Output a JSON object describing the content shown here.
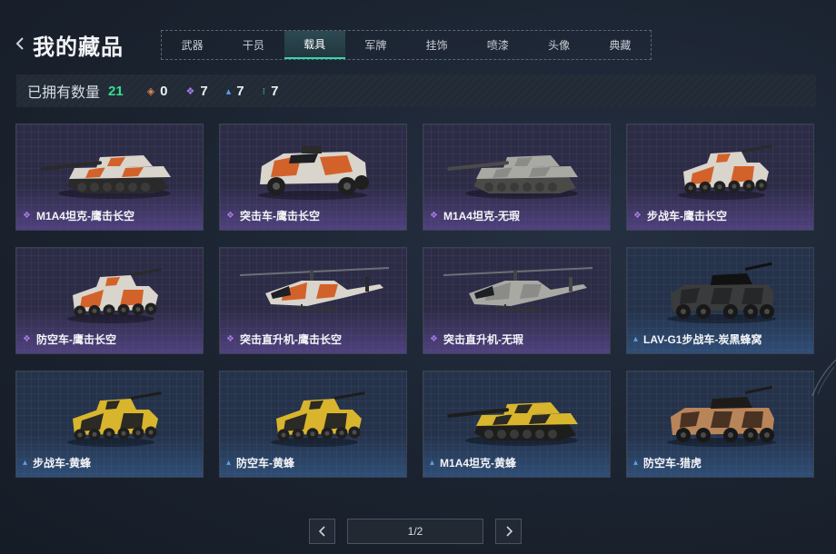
{
  "header": {
    "title": "我的藏品",
    "tabs": [
      "武器",
      "干员",
      "载具",
      "军牌",
      "挂饰",
      "喷漆",
      "头像",
      "典藏"
    ],
    "active_tab": 2
  },
  "owned": {
    "label": "已拥有数量",
    "total": "21",
    "rarities": [
      {
        "icon": "orange-diamond-icon",
        "color": "#e0894a",
        "count": "0"
      },
      {
        "icon": "purple-diamond-icon",
        "color": "#a77be6",
        "count": "7"
      },
      {
        "icon": "blue-chevron-icon",
        "color": "#5b9ee8",
        "count": "7"
      },
      {
        "icon": "green-dots-icon",
        "color": "#3fd6a0",
        "count": "7"
      }
    ]
  },
  "items": [
    {
      "name": "M1A4坦克-鹰击长空",
      "rarity": "purple",
      "art": "tank",
      "camo": "orange"
    },
    {
      "name": "突击车-鹰击长空",
      "rarity": "purple",
      "art": "truck",
      "camo": "orange"
    },
    {
      "name": "M1A4坦克-无瑕",
      "rarity": "purple",
      "art": "tank",
      "camo": "gray"
    },
    {
      "name": "步战车-鹰击长空",
      "rarity": "purple",
      "art": "ifv",
      "camo": "orange"
    },
    {
      "name": "防空车-鹰击长空",
      "rarity": "purple",
      "art": "ifv",
      "camo": "orange"
    },
    {
      "name": "突击直升机-鹰击长空",
      "rarity": "purple",
      "art": "heli",
      "camo": "orange"
    },
    {
      "name": "突击直升机-无瑕",
      "rarity": "purple",
      "art": "heli",
      "camo": "gray"
    },
    {
      "name": "LAV-G1步战车-炭黑蜂窝",
      "rarity": "blue",
      "art": "apc",
      "camo": "black"
    },
    {
      "name": "步战车-黄蜂",
      "rarity": "blue",
      "art": "ifv",
      "camo": "yellow"
    },
    {
      "name": "防空车-黄蜂",
      "rarity": "blue",
      "art": "ifv",
      "camo": "yellow"
    },
    {
      "name": "M1A4坦克-黄蜂",
      "rarity": "blue",
      "art": "tank",
      "camo": "yellow"
    },
    {
      "name": "防空车-猎虎",
      "rarity": "blue",
      "art": "apc",
      "camo": "tiger"
    }
  ],
  "pagination": {
    "label": "1/2"
  },
  "colors": {
    "accent": "#35d6a8",
    "owned_total": "#35e08f",
    "purple_rarity": "#a77be6",
    "blue_rarity": "#5b9ee8"
  }
}
